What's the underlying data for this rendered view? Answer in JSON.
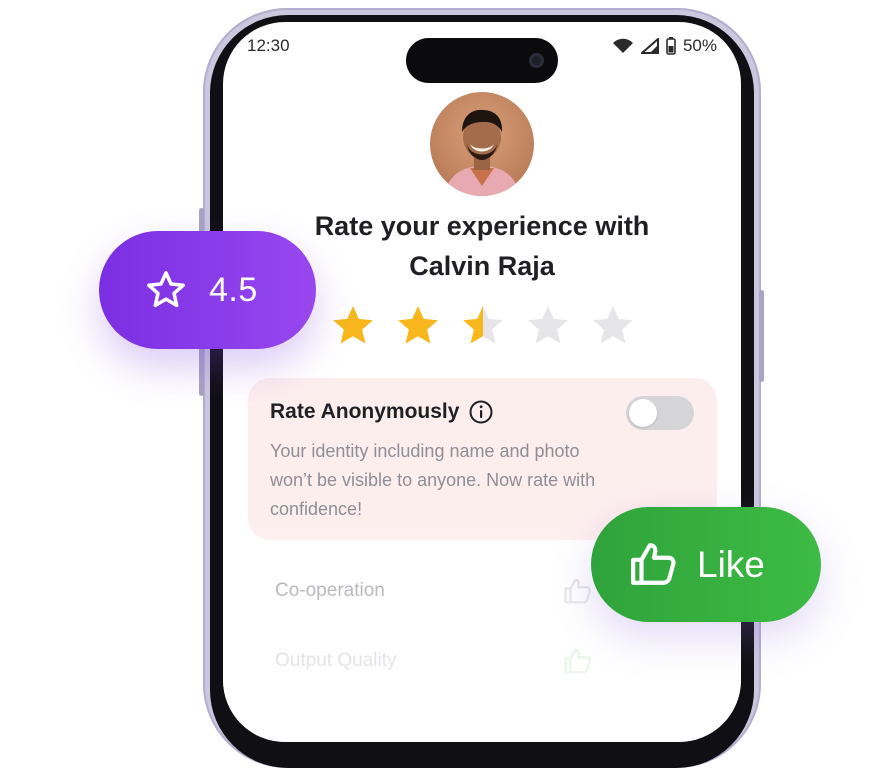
{
  "status_bar": {
    "time": "12:30",
    "battery": "50%"
  },
  "profile": {
    "title_line1": "Rate your experience with",
    "title_line2": "Calvin Raja"
  },
  "rating": {
    "value": 2.5,
    "max": 5
  },
  "anonymous": {
    "title": "Rate Anonymously",
    "description": "Your identity including name and photo won’t be visible to anyone. Now rate with confidence!",
    "enabled": false
  },
  "categories": [
    {
      "label": "Co-operation"
    },
    {
      "label": "Output Quality"
    }
  ],
  "rating_badge": {
    "value": "4.5"
  },
  "like_badge": {
    "label": "Like"
  },
  "colors": {
    "star_filled": "#f8b81d",
    "star_empty": "#e6e6e8",
    "badge_purple": "#8a3dea",
    "badge_green": "#36b13f",
    "card_bg": "#fdeeee"
  },
  "icons": {
    "wifi": "wifi-icon",
    "signal": "signal-icon",
    "battery": "battery-icon",
    "info": "info-icon",
    "star": "star-icon",
    "thumbs_up": "thumbs-up-icon"
  }
}
